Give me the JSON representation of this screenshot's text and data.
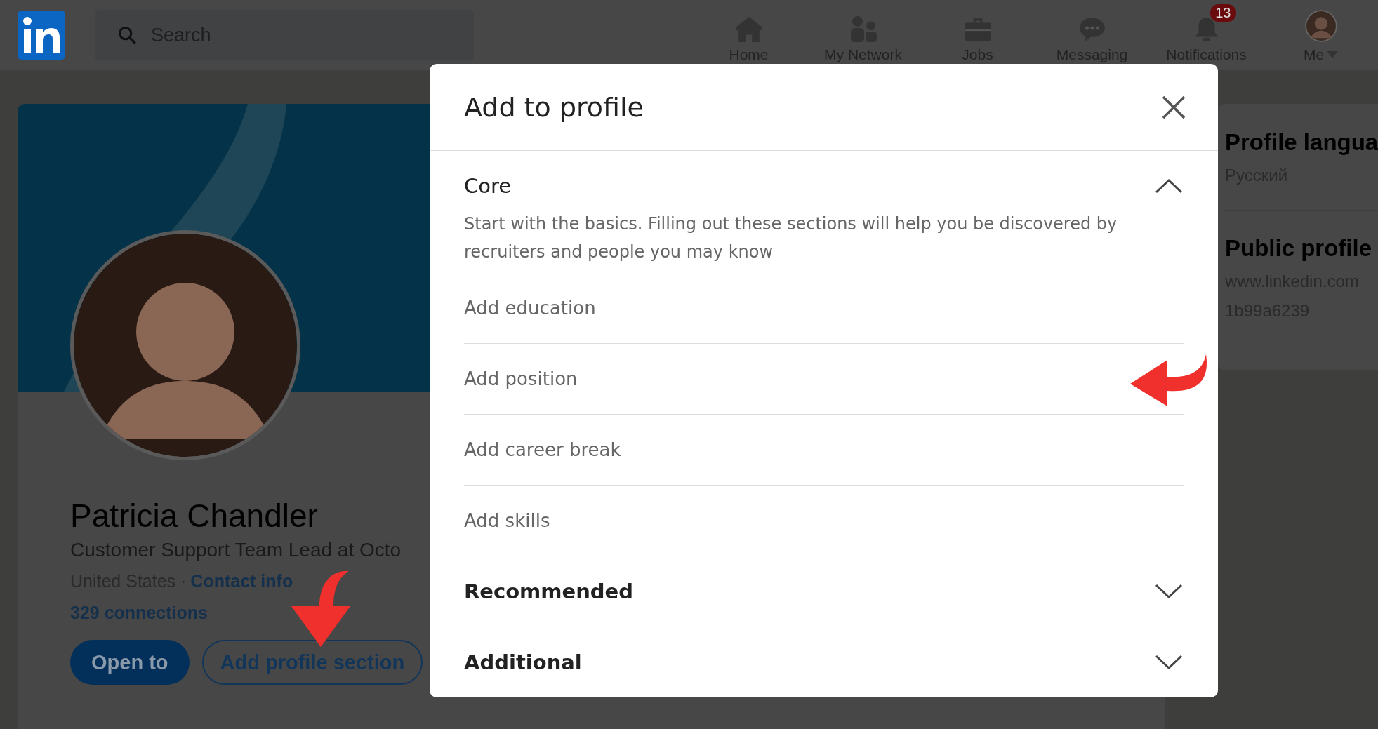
{
  "nav": {
    "search": {
      "placeholder": "Search"
    },
    "items": [
      {
        "label": "Home",
        "kind": "home"
      },
      {
        "label": "My Network",
        "kind": "network"
      },
      {
        "label": "Jobs",
        "kind": "jobs"
      },
      {
        "label": "Messaging",
        "kind": "messaging"
      },
      {
        "label": "Notifications",
        "kind": "notifications",
        "badge": "13"
      },
      {
        "label": "Me",
        "kind": "me"
      }
    ]
  },
  "profile": {
    "name": "Patricia Chandler",
    "headline": "Customer Support Team Lead at Octo",
    "location": "United States ·",
    "contact_link": "Contact info",
    "connections": "329 connections",
    "buttons": [
      {
        "label": "Open to",
        "kind": "primary"
      },
      {
        "label": "Add profile section",
        "kind": "outline"
      }
    ]
  },
  "sidebar": {
    "sections": [
      {
        "title": "Profile langua",
        "lines": [
          "Русский"
        ]
      },
      {
        "title": "Public profile",
        "lines": [
          "www.linkedin.com",
          "1b99a6239"
        ]
      }
    ]
  },
  "modal": {
    "title": "Add to profile",
    "sections": [
      {
        "title": "Core",
        "expanded": true,
        "description": "Start with the basics. Filling out these sections will help you be discovered by recruiters and people you may know",
        "items": [
          "Add education",
          "Add position",
          "Add career break",
          "Add skills"
        ]
      },
      {
        "title": "Recommended",
        "expanded": false
      },
      {
        "title": "Additional",
        "expanded": false
      }
    ]
  }
}
